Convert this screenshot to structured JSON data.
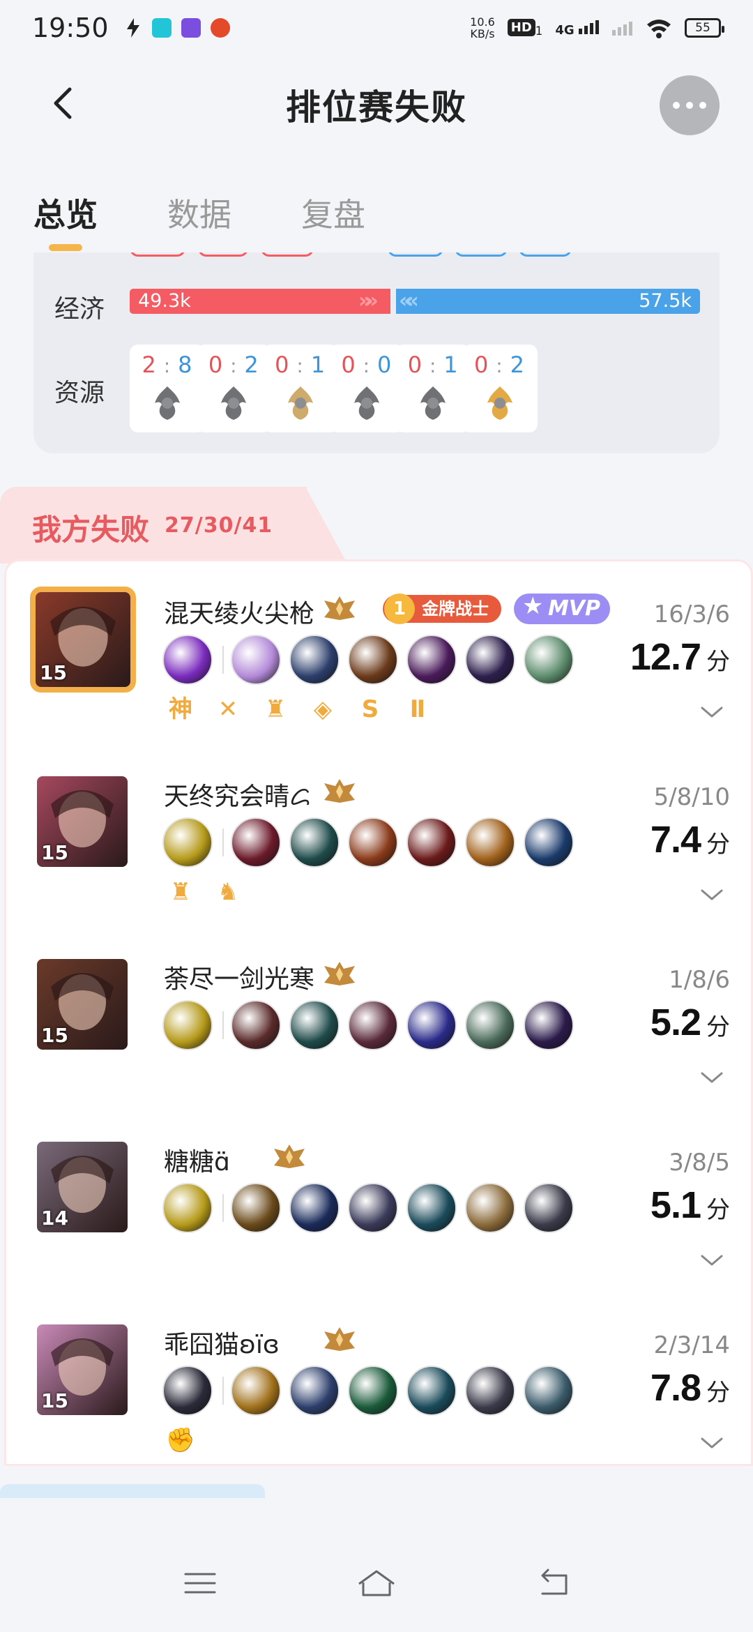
{
  "status_bar": {
    "time": "19:50",
    "net_speed_value": "10.6",
    "net_speed_unit": "KB/s",
    "hd": "HD",
    "hd_sub": "1",
    "network": "4G",
    "battery": "55"
  },
  "header": {
    "title": "排位赛失败"
  },
  "tabs": [
    {
      "label": "总览",
      "active": true
    },
    {
      "label": "数据",
      "active": false
    },
    {
      "label": "复盘",
      "active": false
    }
  ],
  "overview": {
    "economy": {
      "label": "经济",
      "red_value": "49.3k",
      "blue_value": "57.5k",
      "red_fraction": 0.461,
      "blue_fraction": 0.539
    },
    "resources": {
      "label": "资源",
      "items": [
        {
          "red": "2",
          "blue": "8",
          "icon": "tyrant-icon"
        },
        {
          "red": "0",
          "blue": "2",
          "icon": "shadow-tyrant-icon"
        },
        {
          "red": "0",
          "blue": "1",
          "icon": "storm-dragon-icon"
        },
        {
          "red": "0",
          "blue": "0",
          "icon": "overlord-icon"
        },
        {
          "red": "0",
          "blue": "1",
          "icon": "dark-tyrant-icon"
        },
        {
          "red": "0",
          "blue": "2",
          "icon": "fire-dragon-icon"
        }
      ]
    }
  },
  "team": {
    "label": "我方失败",
    "kda": "27/30/41",
    "players": [
      {
        "name": "混天绫火尖枪",
        "level": "15",
        "kda": "16/3/6",
        "score": "12.7",
        "unit": "分",
        "mvp": true,
        "gold_badge": "金牌战士",
        "mvp_badge": "MVP",
        "tags": [
          "神",
          "✕",
          "♜",
          "◈",
          "S",
          "Ⅱ"
        ],
        "item_colors": [
          "#7a2bbd",
          "#b38ad8",
          "#2c3e6b",
          "#6b3a1a",
          "#4a1b5a",
          "#2d1f4d",
          "#5d8d6d"
        ],
        "avatar_color": "#8a3a2a"
      },
      {
        "name": "天终究会晴ᝯ",
        "level": "15",
        "kda": "5/8/10",
        "score": "7.4",
        "unit": "分",
        "mvp": false,
        "tags": [
          "♜",
          "♞"
        ],
        "item_colors": [
          "#b59a1a",
          "#6b1a2a",
          "#1f4a4a",
          "#8a3a1a",
          "#6b1a1a",
          "#a0601a",
          "#1a3a6b"
        ],
        "avatar_color": "#a6485e"
      },
      {
        "name": "荼尽一剑光寒",
        "level": "15",
        "kda": "1/8/6",
        "score": "5.2",
        "unit": "分",
        "mvp": false,
        "tags": [],
        "item_colors": [
          "#b59a1a",
          "#5a2a2a",
          "#1f4a4a",
          "#5a2a3a",
          "#2a2a8a",
          "#4a6a5a",
          "#2a1a4a"
        ],
        "avatar_color": "#6a3a2a"
      },
      {
        "name": "糖糖ɑ̈",
        "level": "14",
        "kda": "3/8/5",
        "score": "5.1",
        "unit": "分",
        "mvp": false,
        "tags": [],
        "item_colors": [
          "#b59a1a",
          "#6a4a1a",
          "#1a2a5a",
          "#3a3a5a",
          "#1a4a5a",
          "#8a6a3a",
          "#3a3a4a"
        ],
        "avatar_color": "#7a6a7a"
      },
      {
        "name": "乖囧猫ʚïɞ",
        "level": "15",
        "kda": "2/3/14",
        "score": "7.8",
        "unit": "分",
        "mvp": false,
        "tags": [
          "✊"
        ],
        "item_colors": [
          "#2a2a3a",
          "#a0701a",
          "#2c3e6b",
          "#1a5a3a",
          "#1a4a5a",
          "#3a3a4a",
          "#3a5a6a"
        ],
        "avatar_color": "#c98ab8"
      }
    ]
  }
}
